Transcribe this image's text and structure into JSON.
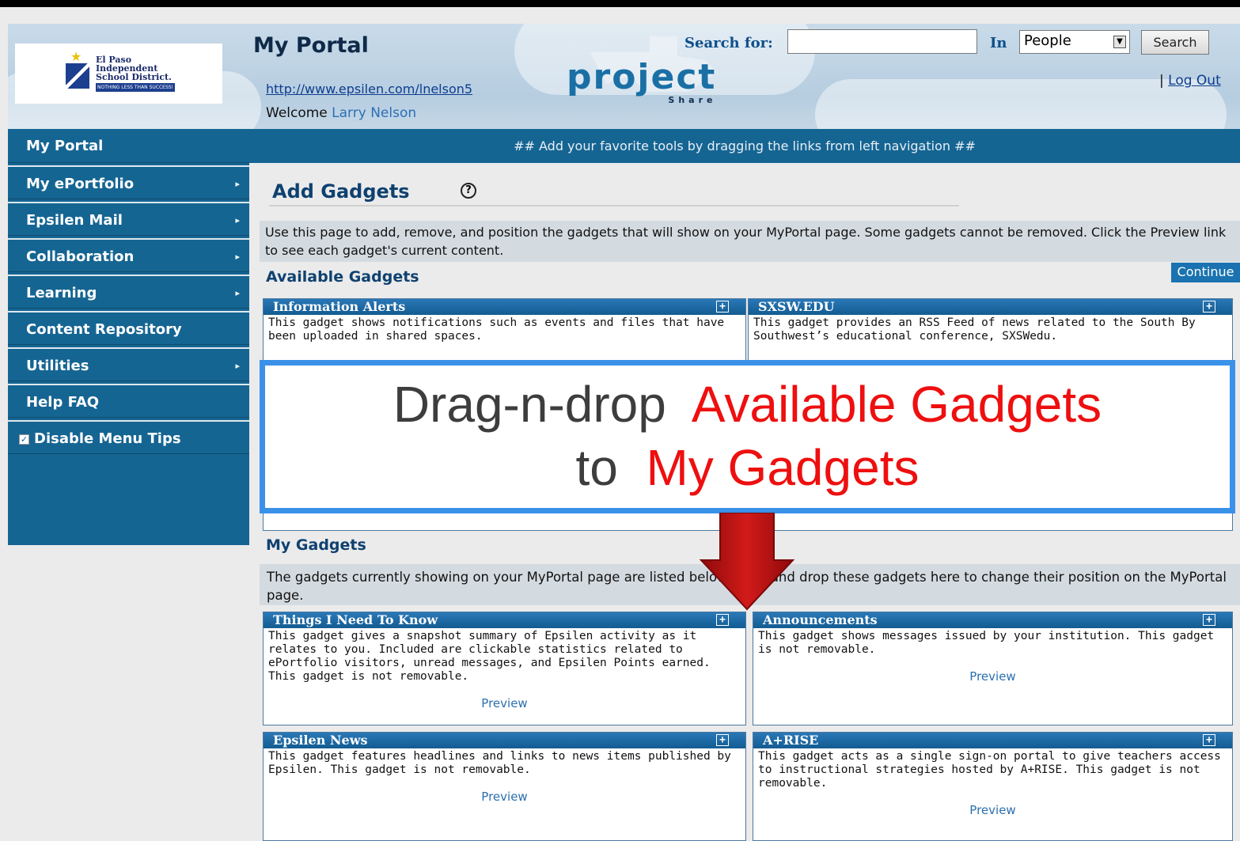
{
  "header": {
    "district_name": "El Paso Independent School District.",
    "district_name_lines": [
      "El Paso",
      "Independent",
      "School District."
    ],
    "district_tagline": "NOTHING LESS THAN SUCCESS!",
    "portal_title": "My Portal",
    "portal_url": "http://www.epsilen.com/lnelson5",
    "welcome_label": "Welcome",
    "user_name": "Larry Nelson",
    "project_logo_word": "project",
    "project_logo_sub": "Share",
    "search_label": "Search for:",
    "search_value": "",
    "in_label": "In",
    "in_selected": "People",
    "search_button": "Search",
    "logout_prefix": "|",
    "logout_label": "Log Out"
  },
  "nav": {
    "hint": "## Add your favorite tools by dragging the links from left navigation ##"
  },
  "sidebar": {
    "items": [
      {
        "label": "My Portal",
        "has_submenu": false
      },
      {
        "label": "My ePortfolio",
        "has_submenu": true
      },
      {
        "label": "Epsilen Mail",
        "has_submenu": true
      },
      {
        "label": "Collaboration",
        "has_submenu": true
      },
      {
        "label": "Learning",
        "has_submenu": true
      },
      {
        "label": "Content Repository",
        "has_submenu": false
      },
      {
        "label": "Utilities",
        "has_submenu": true
      },
      {
        "label": "Help FAQ",
        "has_submenu": false
      }
    ],
    "disable_tips": {
      "label": "Disable Menu Tips",
      "checked": true
    }
  },
  "main": {
    "title": "Add Gadgets",
    "intro": "Use this page to add, remove, and position the gadgets that will show on your MyPortal page. Some gadgets cannot be removed. Click the Preview link to see each gadget's current content.",
    "available_heading": "Available Gadgets",
    "continue_button": "Continue",
    "available_gadgets": [
      {
        "title": "Information Alerts",
        "description": "This gadget shows notifications such as events and files that have been uploaded in shared spaces."
      },
      {
        "title": "SXSW.EDU",
        "description": "This gadget provides an RSS Feed of news related to the South By Southwest’s educational conference, SXSWedu."
      }
    ],
    "my_heading": "My Gadgets",
    "my_intro": "The gadgets currently showing on your MyPortal page are listed below. Drag and drop these gadgets here to change their position on the MyPortal page.",
    "my_gadgets": [
      {
        "title": "Things I Need To Know",
        "description": "This gadget gives a snapshot summary of Epsilen activity as it relates to you. Included are clickable statistics related to ePortfolio visitors, unread messages, and Epsilen Points earned. This gadget is not removable.",
        "preview": "Preview"
      },
      {
        "title": "Announcements",
        "description": "This gadget shows messages issued by your institution. This gadget is not removable.",
        "preview": "Preview"
      },
      {
        "title": "Epsilen News",
        "description": "This gadget features headlines and links to news items published by Epsilen. This gadget is not removable.",
        "preview": "Preview"
      },
      {
        "title": "A+RISE",
        "description": "This gadget acts as a single sign-on portal to give teachers access to instructional strategies hosted by A+RISE. This gadget is not removable.",
        "preview": "Preview"
      }
    ]
  },
  "callout": {
    "line1_part1": "Drag-n-drop",
    "line1_part2": "Available Gadgets",
    "line2_part1": "to",
    "line2_part2": "My Gadgets"
  },
  "colors": {
    "nav_blue": "#156593",
    "accent_red": "#ee0f0f",
    "callout_border": "#3a91e8",
    "arrow_red": "#c41212"
  },
  "icons": {
    "help": "help-circle-icon",
    "expand": "plus-box-icon",
    "submenu": "chevron-right-icon",
    "arrow": "down-arrow-icon"
  }
}
